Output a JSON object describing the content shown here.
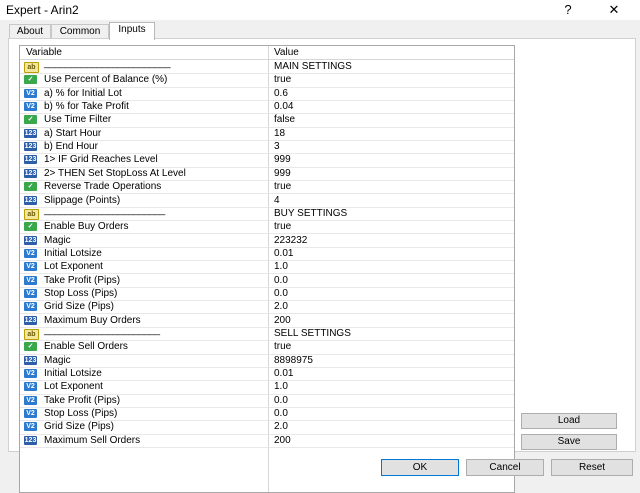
{
  "window": {
    "title": "Expert - Arin2",
    "help_glyph": "?",
    "close_glyph": "✕"
  },
  "tabs": [
    {
      "label": "About"
    },
    {
      "label": "Common"
    },
    {
      "label": "Inputs",
      "active": true
    }
  ],
  "grid": {
    "columns": [
      "Variable",
      "Value"
    ],
    "rows": [
      {
        "icon": "ab",
        "name": "________________________",
        "value": "MAIN SETTINGS"
      },
      {
        "icon": "bool",
        "name": "Use Percent of Balance (%)",
        "value": "true"
      },
      {
        "icon": "dbl",
        "name": "a) % for Initial Lot",
        "value": "0.6"
      },
      {
        "icon": "dbl",
        "name": "b) % for Take Profit",
        "value": "0.04"
      },
      {
        "icon": "bool",
        "name": "Use Time Filter",
        "value": "false"
      },
      {
        "icon": "int",
        "name": "a) Start Hour",
        "value": "18"
      },
      {
        "icon": "int",
        "name": "b) End Hour",
        "value": "3"
      },
      {
        "icon": "int",
        "name": "1> IF Grid Reaches Level",
        "value": "999"
      },
      {
        "icon": "int",
        "name": "2> THEN Set StopLoss At Level",
        "value": "999"
      },
      {
        "icon": "bool",
        "name": "Reverse Trade Operations",
        "value": "true"
      },
      {
        "icon": "int",
        "name": "Slippage (Points)",
        "value": "4"
      },
      {
        "icon": "ab",
        "name": "_______________________",
        "value": "BUY SETTINGS"
      },
      {
        "icon": "bool",
        "name": "Enable Buy Orders",
        "value": "true"
      },
      {
        "icon": "int",
        "name": "Magic",
        "value": "223232"
      },
      {
        "icon": "dbl",
        "name": "Initial Lotsize",
        "value": "0.01"
      },
      {
        "icon": "dbl",
        "name": "Lot Exponent",
        "value": "1.0"
      },
      {
        "icon": "dbl",
        "name": "Take Profit (Pips)",
        "value": "0.0"
      },
      {
        "icon": "dbl",
        "name": "Stop Loss (Pips)",
        "value": "0.0"
      },
      {
        "icon": "dbl",
        "name": "Grid Size (Pips)",
        "value": "2.0"
      },
      {
        "icon": "int",
        "name": "Maximum Buy Orders",
        "value": "200"
      },
      {
        "icon": "ab",
        "name": "______________________",
        "value": "SELL SETTINGS"
      },
      {
        "icon": "bool",
        "name": "Enable Sell Orders",
        "value": "true"
      },
      {
        "icon": "int",
        "name": "Magic",
        "value": "8898975"
      },
      {
        "icon": "dbl",
        "name": "Initial Lotsize",
        "value": "0.01"
      },
      {
        "icon": "dbl",
        "name": "Lot Exponent",
        "value": "1.0"
      },
      {
        "icon": "dbl",
        "name": "Take Profit (Pips)",
        "value": "0.0"
      },
      {
        "icon": "dbl",
        "name": "Stop Loss (Pips)",
        "value": "0.0"
      },
      {
        "icon": "dbl",
        "name": "Grid Size (Pips)",
        "value": "2.0"
      },
      {
        "icon": "int",
        "name": "Maximum Sell Orders",
        "value": "200"
      }
    ]
  },
  "icon_glyphs": {
    "ab": "ab",
    "bool": "✓",
    "dbl": "V2",
    "int": "123"
  },
  "side_buttons": {
    "load": "Load",
    "save": "Save"
  },
  "footer": {
    "ok": "OK",
    "cancel": "Cancel",
    "reset": "Reset"
  }
}
